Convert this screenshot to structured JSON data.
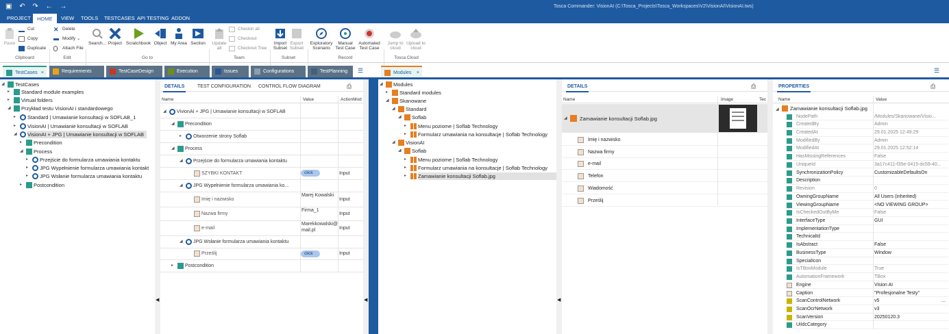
{
  "window": {
    "title": "Tosca Commander: VisionAI (C:\\Tosca_Projects\\Tosca_Workspaces\\V2\\VisionAI\\VisionAI.tws)"
  },
  "menu": [
    "PROJECT",
    "HOME",
    "VIEW",
    "TOOLS",
    "TESTCASES",
    "API TESTING",
    "ADDON"
  ],
  "ribbon": {
    "clipboard": {
      "paste": "Paste",
      "cut": "Cut",
      "copy": "Copy",
      "duplicate": "Duplicate",
      "group": "Clipboard"
    },
    "edit": {
      "delete": "Delete",
      "modify": "Modify",
      "attach": "Attach File",
      "group": "Edit"
    },
    "goto": {
      "search": "Search...",
      "project": "Project",
      "scratchbook": "Scratchbook",
      "object": "Object",
      "myarea": "My Area",
      "section": "Section",
      "group": "Go to"
    },
    "team": {
      "update": "Update all",
      "checkin": "Checkin all",
      "checkout": "Checkout",
      "checkout_tree": "Checkout Tree",
      "group": "Team"
    },
    "subset": {
      "import": "Import Subset",
      "export": "Export Subset",
      "group": "Subset"
    },
    "record": {
      "exploratory": "Exploratory Scenario",
      "manual": "Manual Test Case",
      "automated": "Automated Test Case",
      "group": "Record"
    },
    "cloud": {
      "jump": "Jump to cloud",
      "upload": "Upload to cloud",
      "group": "Tosca Cloud"
    }
  },
  "tabs": [
    "TestCases",
    "Requirements",
    "TestCaseDesign",
    "Execution",
    "Issues",
    "Configurations",
    "TestPlanning"
  ],
  "modules_tab": "Modules",
  "colors": {
    "brand": "#1e5aa0",
    "tab_testcases": "#2a9b8c",
    "tab_requirements": "#e8a317",
    "tab_testcasedesign": "#c0392b",
    "tab_execution": "#6d8e1e",
    "tab_issues": "#2b5797",
    "tab_configurations": "#5a6e7f",
    "tab_testplanning": "#40607c",
    "module_orange": "#e67e22",
    "button_blue": "#a9c8ec"
  },
  "left_tree": [
    {
      "label": "TestCases"
    },
    {
      "label": "Standard module examples"
    },
    {
      "label": "Virtual folders"
    },
    {
      "label": "Przykład testu VisionAI i standardowego"
    },
    {
      "label": "Standard | Umawianie konsultacji w SOFLAB_1"
    },
    {
      "label": "VisionAI | Umawianie konsultacji w SOFLAB"
    },
    {
      "label": "VisionAI + JPG | Umawianie konsultacji w SOFLAB"
    },
    {
      "label": "Precondition"
    },
    {
      "label": "Process"
    },
    {
      "label": "Przejście do formularza umawiania kontaktu"
    },
    {
      "label": "JPG Wypełnienie formularza umawiania kontakt"
    },
    {
      "label": "JPG Wsłanie formularza umawiania kontaktu"
    },
    {
      "label": "Postcondition"
    }
  ],
  "details_tabs": [
    "DETAILS",
    "TEST CONFIGURATION",
    "CONTROL FLOW DIAGRAM"
  ],
  "details_headers": [
    "Name",
    "Value",
    "ActionMod"
  ],
  "details_rows": [
    {
      "name": "VivionAI + JPG | Umawianie konsultacji w SOFLAB"
    },
    {
      "name": "Precondition"
    },
    {
      "name": "Otworzenie strony Soflab"
    },
    {
      "name": "Process"
    },
    {
      "name": "Przejście do formularza umawiania kontaktu"
    },
    {
      "name": "SZYBKI KONTAKT",
      "value": "click",
      "action": "Input"
    },
    {
      "name": "JPG Wypełnienie formularza umawiania ko..."
    },
    {
      "name": "Imię i nazwisko",
      "value": "Marej Kowalski",
      "action": "Input"
    },
    {
      "name": "Nazwa firmy",
      "value": "Firma_1",
      "action": "Input"
    },
    {
      "name": "e-mail",
      "value": "Marekkowalski@mail.pl",
      "action": "Input"
    },
    {
      "name": "JPG Wsłanie formularza umawiania kontaktu"
    },
    {
      "name": "Prześlij",
      "value": "click",
      "action": "Input"
    },
    {
      "name": "Postcondition"
    }
  ],
  "modules_tree": [
    {
      "label": "Modules"
    },
    {
      "label": "Standard modules"
    },
    {
      "label": "Skanowane"
    },
    {
      "label": "Standard"
    },
    {
      "label": "Soflab"
    },
    {
      "label": "Menu poziome | Soflab Technology"
    },
    {
      "label": "Formularz umawiania na konsultacje | Soflab Technology"
    },
    {
      "label": "VisionAI"
    },
    {
      "label": "Soflab"
    },
    {
      "label": "Menu poziome | Soflab Technology"
    },
    {
      "label": "Formularz umawiania na konsultacje | Soflab Technology"
    },
    {
      "label": "Zamawianie konsultacji Soflab.jpg"
    }
  ],
  "module_details": {
    "tab": "DETAILS",
    "headers": [
      "Name",
      "Image",
      "Tec"
    ],
    "title": "Zamawianie konsultacji Soflab.jpg",
    "items": [
      "Imię i nazwisko",
      "Nazwa firmy",
      "e-mail",
      "Telefon",
      "Wiadomość",
      "Prześlij"
    ]
  },
  "properties": {
    "tab": "PROPERTIES",
    "headers": [
      "Name",
      "Value"
    ],
    "title": "Zamawianie konsultacji Soflab.jpg",
    "rows": [
      {
        "name": "NodePath",
        "value": "/Modules/Skanowane/Visio...",
        "grey": true
      },
      {
        "name": "CreatedBy",
        "value": "Admin",
        "grey": true
      },
      {
        "name": "CreatedAt",
        "value": "29.01.2025 12:49:29",
        "grey": true
      },
      {
        "name": "ModifiedBy",
        "value": "Admin",
        "grey": true
      },
      {
        "name": "ModifiedAt",
        "value": "29.01.2025 12:52:14",
        "grey": true
      },
      {
        "name": "HasMissingReferences",
        "value": "False",
        "grey": true
      },
      {
        "name": "UniqueId",
        "value": "3a17c411-f35e-0415-dc59-40...",
        "grey": true
      },
      {
        "name": "SynchronizationPolicy",
        "value": "CustomizableDefaultsOn"
      },
      {
        "name": "Description",
        "value": ""
      },
      {
        "name": "Revision",
        "value": "0",
        "grey": true
      },
      {
        "name": "OwningGroupName",
        "value": "All Users (inherited)"
      },
      {
        "name": "ViewingGroupName",
        "value": "<NO VIEWING GROUP>"
      },
      {
        "name": "IsCheckedOutByMe",
        "value": "False",
        "grey": true
      },
      {
        "name": "InterfaceType",
        "value": "GUI"
      },
      {
        "name": "ImplementationType",
        "value": ""
      },
      {
        "name": "TechnicalId",
        "value": ""
      },
      {
        "name": "IsAbstract",
        "value": "False"
      },
      {
        "name": "BusinessType",
        "value": "Window"
      },
      {
        "name": "SpecialIcon",
        "value": ""
      },
      {
        "name": "IsTBoxModule",
        "value": "True",
        "grey": true
      },
      {
        "name": "AutomationFramework",
        "value": "TBox",
        "grey": true
      },
      {
        "name": "Engine",
        "value": "Vision AI"
      },
      {
        "name": "Caption",
        "value": "\"Profesjonalne Testy\""
      },
      {
        "name": "ScanControlNetwork",
        "value": "v5"
      },
      {
        "name": "ScanOcrNetwork",
        "value": "v3"
      },
      {
        "name": "ScanVersion",
        "value": "20250120.3"
      },
      {
        "name": "UiIdcCategory",
        "value": ""
      }
    ]
  }
}
